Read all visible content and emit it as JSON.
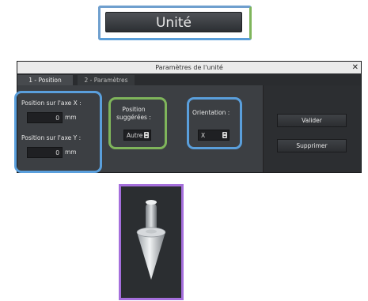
{
  "unit_button": {
    "label": "Unité"
  },
  "dialog": {
    "title": "Paramètres de l'unité",
    "close": "✕",
    "tabs": [
      {
        "label": "1 - Position"
      },
      {
        "label": "2 - Paramètres"
      }
    ],
    "axis_x": {
      "label": "Position sur l'axe X :",
      "value": "0",
      "unit": "mm"
    },
    "axis_y": {
      "label": "Position sur l'axe Y :",
      "value": "0",
      "unit": "mm"
    },
    "suggested": {
      "label": "Position suggérées :",
      "value": "Autre"
    },
    "orientation": {
      "label": "Orientation :",
      "value": "X"
    },
    "validate": "Valider",
    "delete": "Supprimer"
  },
  "colors": {
    "highlight_blue": "#5a9fdc",
    "highlight_green": "#7fb55b",
    "highlight_purple": "#a56fdc",
    "dialog_bg": "#3c3f43"
  },
  "icons": {
    "preview": "cone-arrow-icon"
  }
}
